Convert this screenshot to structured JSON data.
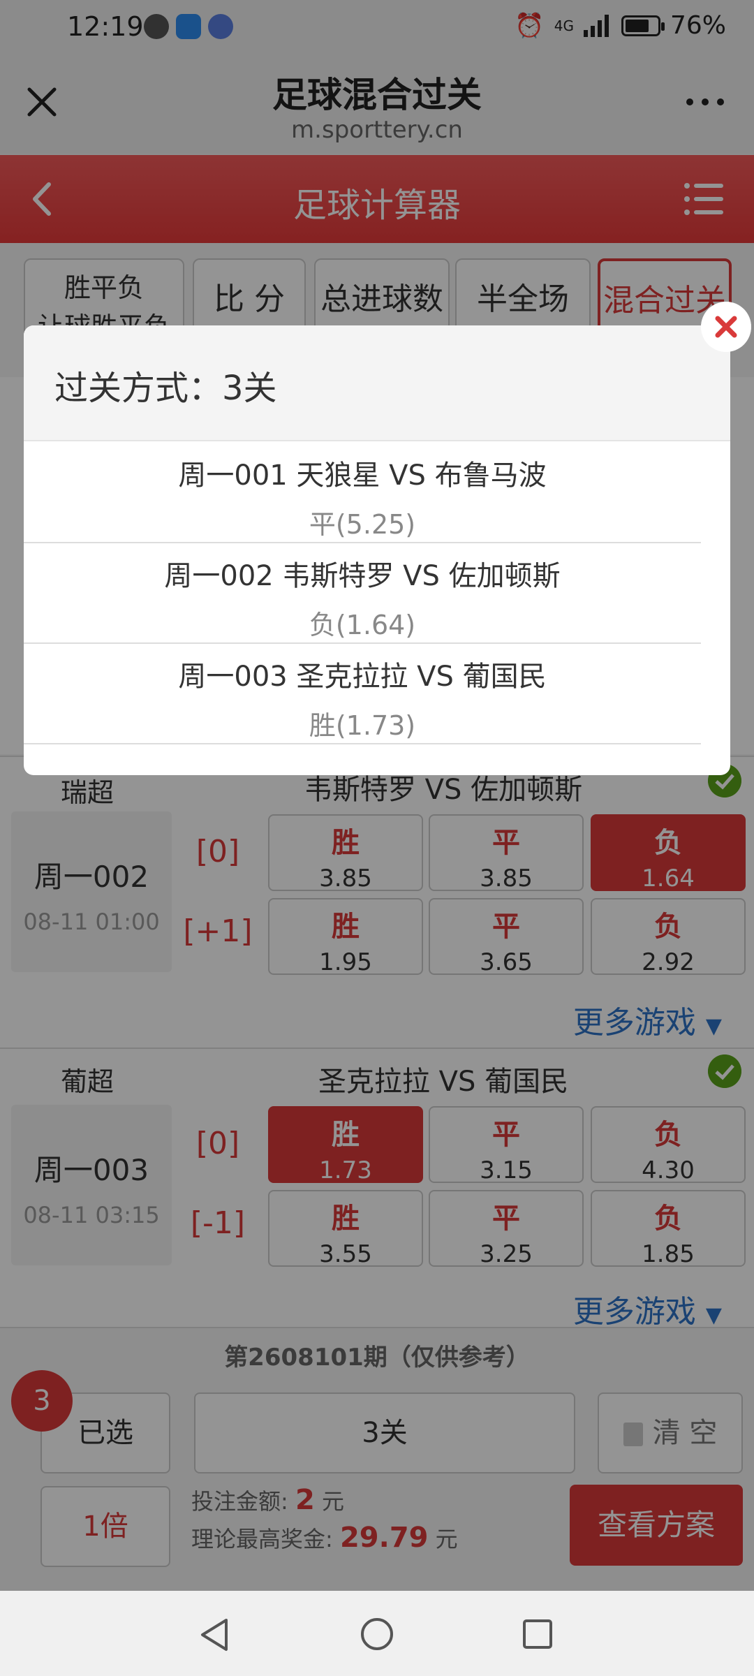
{
  "status_bar": {
    "time": "12:19",
    "battery": "76%",
    "battery_fraction": 0.76,
    "network": "4G"
  },
  "browser": {
    "title": "足球混合过关",
    "url": "m.sporttery.cn"
  },
  "app_header": {
    "title": "足球计算器"
  },
  "tabs": [
    {
      "label": "胜平负",
      "label2": "让球胜平负"
    },
    {
      "label": "比 分"
    },
    {
      "label": "总进球数"
    },
    {
      "label": "半全场"
    },
    {
      "label": "混合过关",
      "active": true
    }
  ],
  "matches": [
    {
      "league": "瑞超",
      "teams": "韦斯特罗  VS  佐加顿斯",
      "number": "周一002",
      "datetime": "08-11 01:00",
      "rows": [
        {
          "handicap": "[0]",
          "odds": [
            {
              "label": "胜",
              "value": "3.85"
            },
            {
              "label": "平",
              "value": "3.85"
            },
            {
              "label": "负",
              "value": "1.64",
              "selected": true
            }
          ]
        },
        {
          "handicap": "[+1]",
          "odds": [
            {
              "label": "胜",
              "value": "1.95"
            },
            {
              "label": "平",
              "value": "3.65"
            },
            {
              "label": "负",
              "value": "2.92"
            }
          ]
        }
      ],
      "more": "更多游戏"
    },
    {
      "league": "葡超",
      "teams": "圣克拉拉  VS  葡国民",
      "number": "周一003",
      "datetime": "08-11 03:15",
      "rows": [
        {
          "handicap": "[0]",
          "odds": [
            {
              "label": "胜",
              "value": "1.73",
              "selected": true
            },
            {
              "label": "平",
              "value": "3.15"
            },
            {
              "label": "负",
              "value": "4.30"
            }
          ]
        },
        {
          "handicap": "[-1]",
          "odds": [
            {
              "label": "胜",
              "value": "3.55"
            },
            {
              "label": "平",
              "value": "3.25"
            },
            {
              "label": "负",
              "value": "1.85"
            }
          ]
        }
      ],
      "more": "更多游戏"
    }
  ],
  "footer": {
    "issue": "第2608101期（仅供参考）",
    "count": "3",
    "selected_label": "已选",
    "pass_type": "3关",
    "clear_label": "清 空",
    "multiplier": "1倍",
    "bet_amount_label": "投注金额:",
    "bet_amount": "2",
    "max_prize_label": "理论最高奖金:",
    "max_prize": "29.79",
    "unit": "元",
    "view_plan": "查看方案"
  },
  "modal": {
    "title": "过关方式：3关",
    "selections": [
      {
        "match": "周一001   天狼星 VS 布鲁马波",
        "pick": "平(5.25)"
      },
      {
        "match": "周一002   韦斯特罗 VS 佐加顿斯",
        "pick": "负(1.64)"
      },
      {
        "match": "周一003   圣克拉拉 VS 葡国民",
        "pick": "胜(1.73)"
      }
    ]
  },
  "colors": {
    "accent": "#d93a3a",
    "link": "#2d73c6",
    "check": "#5aa31b"
  },
  "icons": [
    "close-icon",
    "more-icon",
    "back-icon",
    "menu-icon",
    "check-icon",
    "trash-icon",
    "nav-back-icon",
    "nav-home-icon",
    "nav-recents-icon"
  ]
}
